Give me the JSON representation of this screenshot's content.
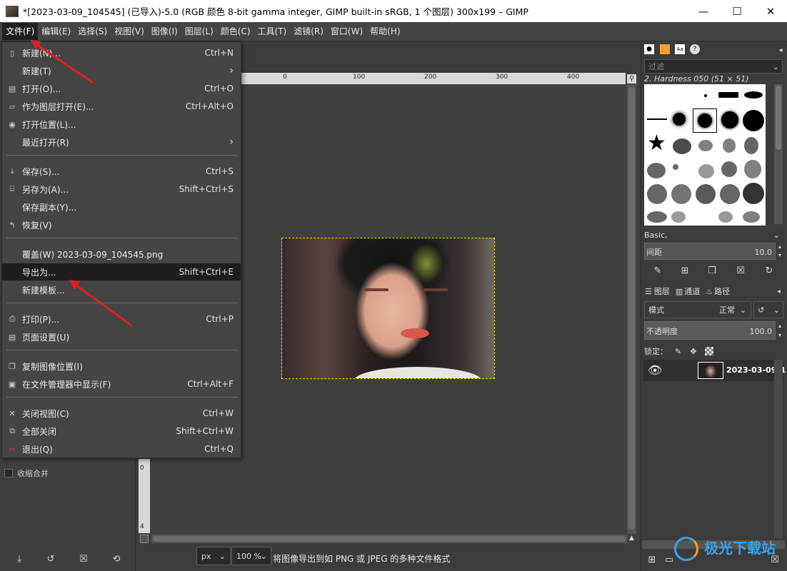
{
  "window": {
    "title": "*[2023-03-09_104545] (已导入)-5.0 (RGB 颜色 8-bit gamma integer, GIMP built-in sRGB, 1 个图层) 300x199 – GIMP",
    "minimize": "—",
    "maximize": "☐",
    "close": "✕"
  },
  "menubar": [
    "文件(F)",
    "编辑(E)",
    "选择(S)",
    "视图(V)",
    "图像(I)",
    "图层(L)",
    "颜色(C)",
    "工具(T)",
    "滤镜(R)",
    "窗口(W)",
    "帮助(H)"
  ],
  "file_menu": {
    "items": [
      {
        "label": "新建(N)...",
        "shortcut": "Ctrl+N",
        "icon": "new-file-icon"
      },
      {
        "label": "新建(T)",
        "shortcut": "",
        "icon": "",
        "submenu": true
      },
      {
        "label": "打开(O)...",
        "shortcut": "Ctrl+O",
        "icon": "open-icon"
      },
      {
        "label": "作为图层打开(E)...",
        "shortcut": "Ctrl+Alt+O",
        "icon": "open-as-layers-icon"
      },
      {
        "label": "打开位置(L)...",
        "shortcut": "",
        "icon": "open-location-icon"
      },
      {
        "label": "最近打开(R)",
        "shortcut": "",
        "icon": "",
        "submenu": true
      },
      {
        "label": "保存(S)...",
        "shortcut": "Ctrl+S",
        "icon": "save-icon"
      },
      {
        "label": "另存为(A)...",
        "shortcut": "Shift+Ctrl+S",
        "icon": "save-as-icon"
      },
      {
        "label": "保存副本(Y)...",
        "shortcut": "",
        "icon": ""
      },
      {
        "label": "恢复(V)",
        "shortcut": "",
        "icon": "revert-icon"
      },
      {
        "label": "覆盖(W) 2023-03-09_104545.png",
        "shortcut": "",
        "icon": ""
      },
      {
        "label": "导出为...",
        "shortcut": "Shift+Ctrl+E",
        "icon": "",
        "highlighted": true
      },
      {
        "label": "新建模板...",
        "shortcut": "",
        "icon": ""
      },
      {
        "label": "打印(P)...",
        "shortcut": "Ctrl+P",
        "icon": "print-icon"
      },
      {
        "label": "页面设置(U)",
        "shortcut": "",
        "icon": "page-setup-icon"
      },
      {
        "label": "复制图像位置(I)",
        "shortcut": "",
        "icon": "copy-location-icon"
      },
      {
        "label": "在文件管理器中显示(F)",
        "shortcut": "Ctrl+Alt+F",
        "icon": "show-in-file-manager-icon"
      },
      {
        "label": "关闭视图(C)",
        "shortcut": "Ctrl+W",
        "icon": "close-view-icon"
      },
      {
        "label": "全部关闭",
        "shortcut": "Shift+Ctrl+W",
        "icon": "close-all-icon"
      },
      {
        "label": "退出(Q)",
        "shortcut": "Ctrl+Q",
        "icon": "quit-icon"
      }
    ]
  },
  "rulers": {
    "h_ticks": [
      "0",
      "100",
      "200",
      "300",
      "400"
    ],
    "v_ticks": [
      "0",
      "4"
    ]
  },
  "statusbar": {
    "unit": "px",
    "zoom": "100 %",
    "message": "将图像导出到如 PNG 或 JPEG 的多种文件格式"
  },
  "left_dock": {
    "merge_label": "收缩合并"
  },
  "brushes": {
    "filter_placeholder": "过滤",
    "current_brush": "2. Hardness 050 (51 × 51)",
    "preset": "Basic,",
    "spacing_label": "间距",
    "spacing_value": "10.0"
  },
  "layers": {
    "tabs": [
      "图层",
      "通道",
      "路径"
    ],
    "mode_label": "模式",
    "mode_value": "正常",
    "opacity_label": "不透明度",
    "opacity_value": "100.0",
    "lock_label": "锁定：",
    "layer_name": "2023-03-09_1"
  },
  "watermark": "极光下载站"
}
